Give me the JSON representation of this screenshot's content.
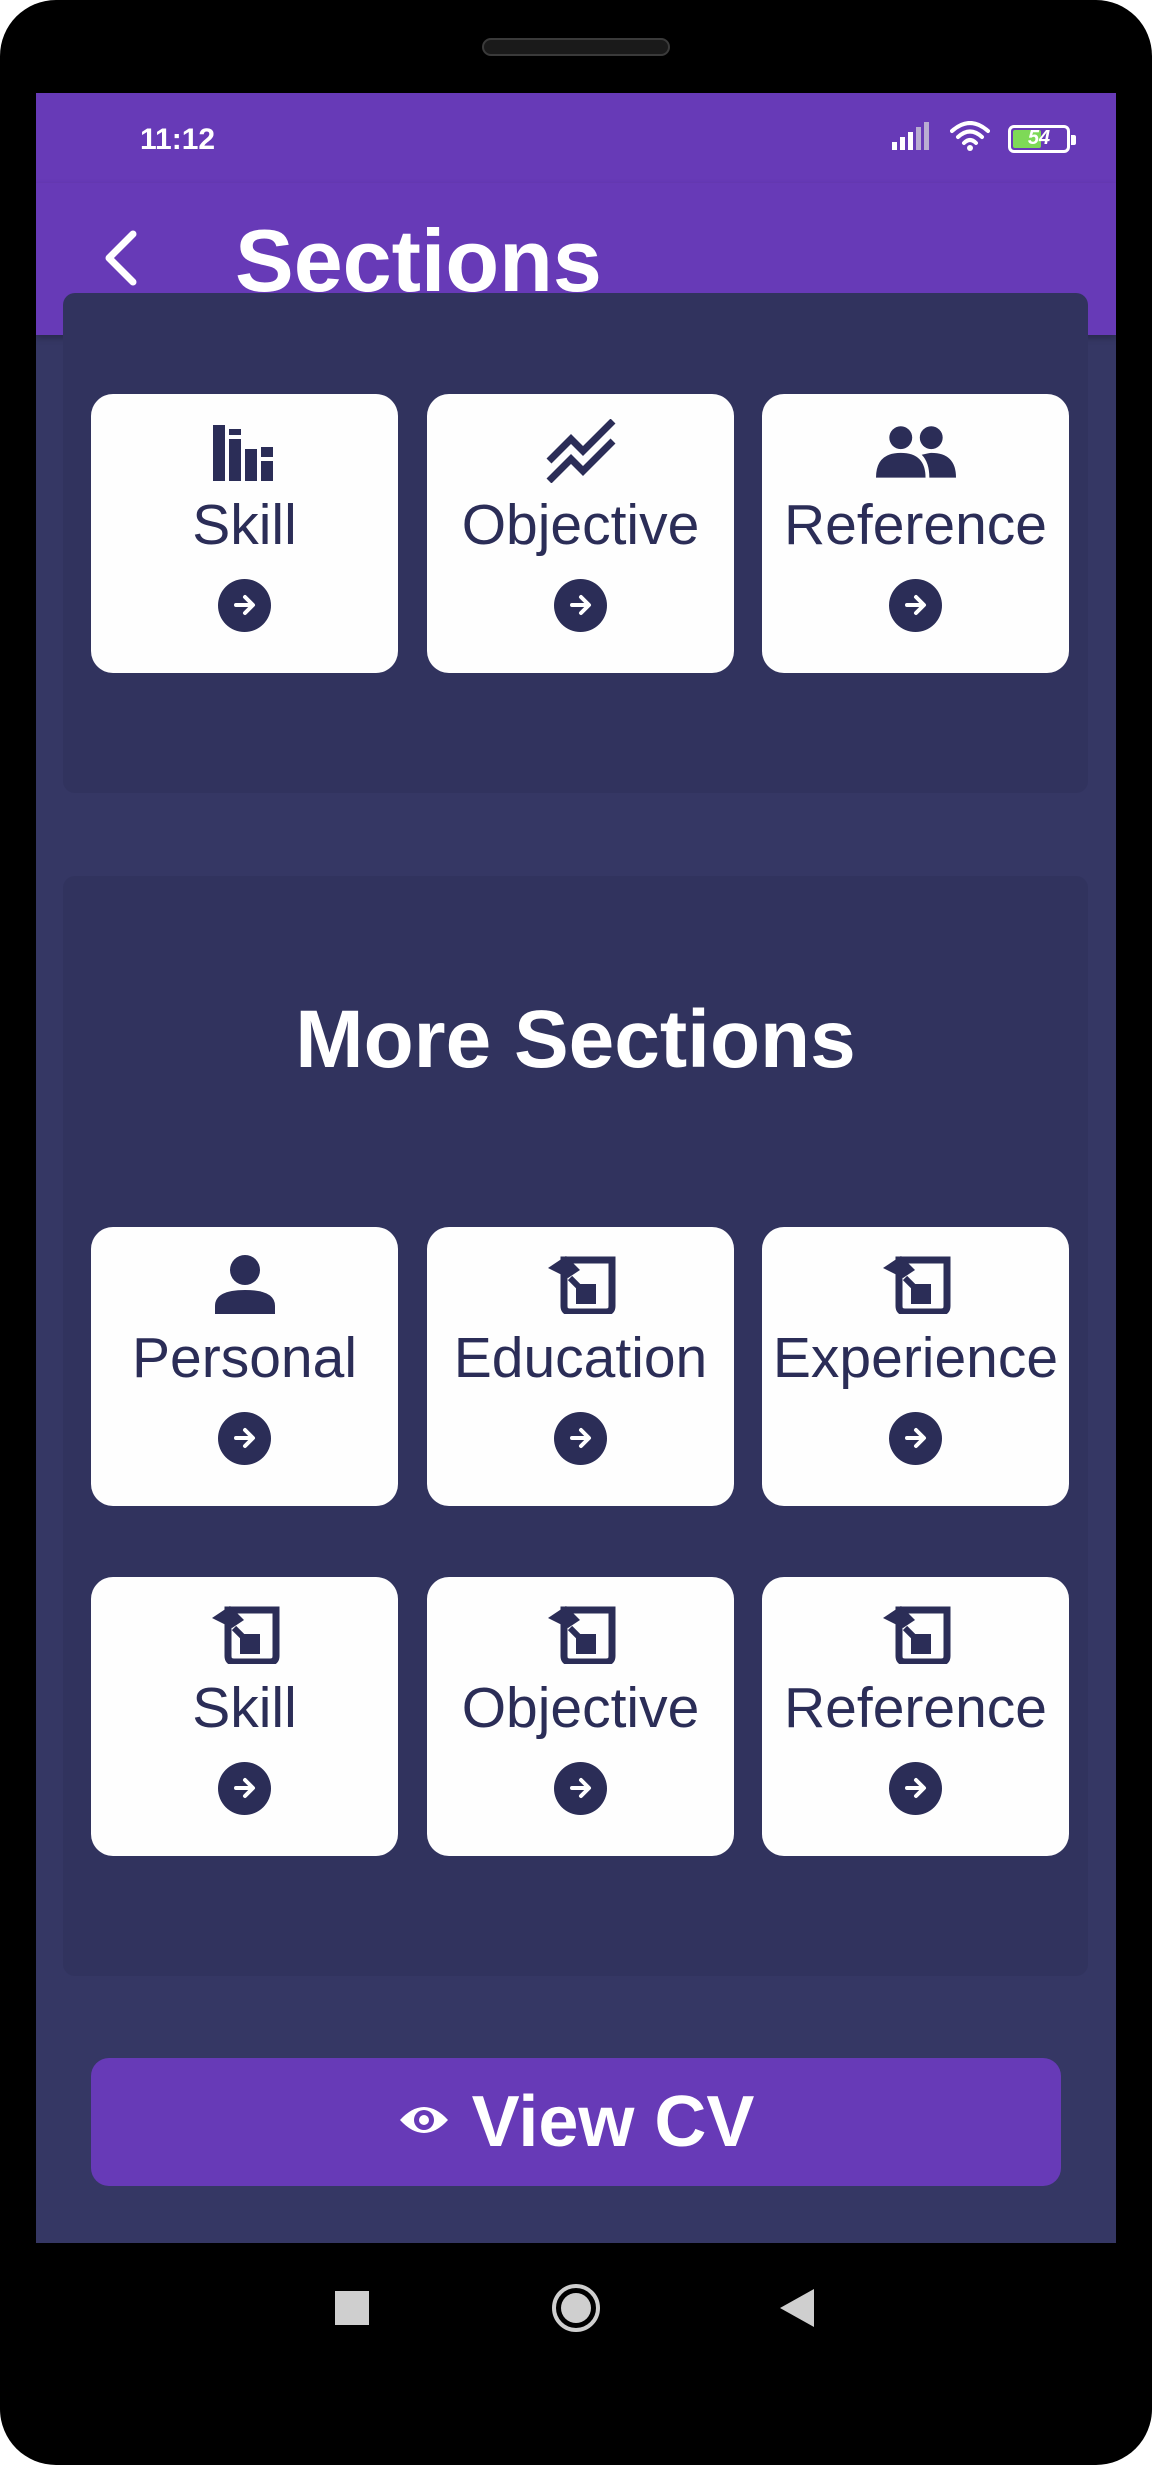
{
  "status_bar": {
    "time": "11:12",
    "battery_level": "54",
    "battery_fill_fraction": 0.54,
    "icons": [
      "signal-icon",
      "wifi-icon",
      "battery-icon"
    ]
  },
  "app_bar": {
    "title": "Sections",
    "back_icon": "chevron-left-icon",
    "background": "#673ab7"
  },
  "top_section": {
    "cards": [
      {
        "label": "Skill",
        "icon": "skill-chart-icon"
      },
      {
        "label": "Objective",
        "icon": "trending-icon"
      },
      {
        "label": "Reference",
        "icon": "people-icon"
      }
    ]
  },
  "more_section": {
    "title": "More Sections",
    "cards": [
      {
        "label": "Personal",
        "icon": "person-icon"
      },
      {
        "label": "Education",
        "icon": "scroll-quill-icon"
      },
      {
        "label": "Experience",
        "icon": "scroll-quill-icon"
      },
      {
        "label": "Skill",
        "icon": "scroll-quill-icon"
      },
      {
        "label": "Objective",
        "icon": "scroll-quill-icon"
      },
      {
        "label": "Reference",
        "icon": "scroll-quill-icon"
      }
    ]
  },
  "view_cv_button": {
    "label": "View CV",
    "icon": "eye-icon"
  },
  "colors": {
    "accent": "#673ab7",
    "screen_background": "#353764",
    "panel_background": "#31335e",
    "card_text": "#2b2d57",
    "card_background": "#fefefe"
  }
}
